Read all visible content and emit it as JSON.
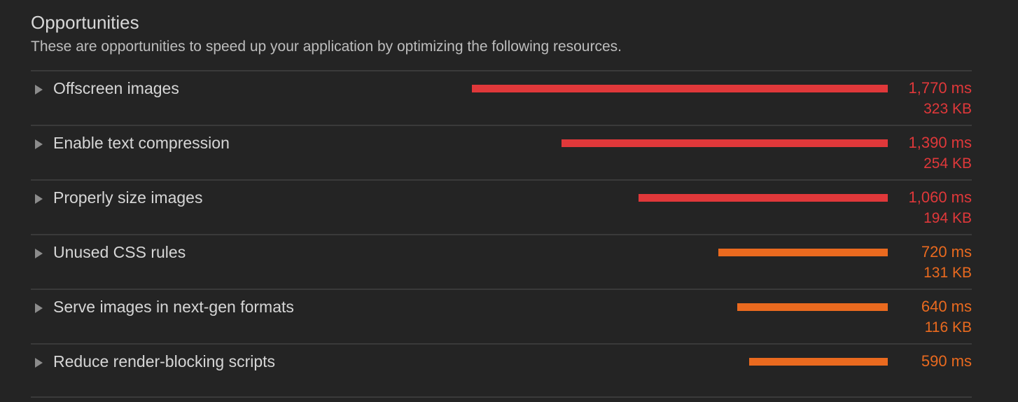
{
  "header": {
    "title": "Opportunities",
    "subtitle": "These are opportunities to speed up your application by optimizing the following resources."
  },
  "colors": {
    "high": "#e0383a",
    "medium": "#ea6a1f"
  },
  "max_ms": 1770,
  "opportunities": [
    {
      "label": "Offscreen images",
      "ms": 1770,
      "ms_text": "1,770 ms",
      "kb_text": "323 KB",
      "severity": "high"
    },
    {
      "label": "Enable text compression",
      "ms": 1390,
      "ms_text": "1,390 ms",
      "kb_text": "254 KB",
      "severity": "high"
    },
    {
      "label": "Properly size images",
      "ms": 1060,
      "ms_text": "1,060 ms",
      "kb_text": "194 KB",
      "severity": "high"
    },
    {
      "label": "Unused CSS rules",
      "ms": 720,
      "ms_text": "720 ms",
      "kb_text": "131 KB",
      "severity": "medium"
    },
    {
      "label": "Serve images in next-gen formats",
      "ms": 640,
      "ms_text": "640 ms",
      "kb_text": "116 KB",
      "severity": "medium"
    },
    {
      "label": "Reduce render-blocking scripts",
      "ms": 590,
      "ms_text": "590 ms",
      "kb_text": "",
      "severity": "medium"
    }
  ]
}
